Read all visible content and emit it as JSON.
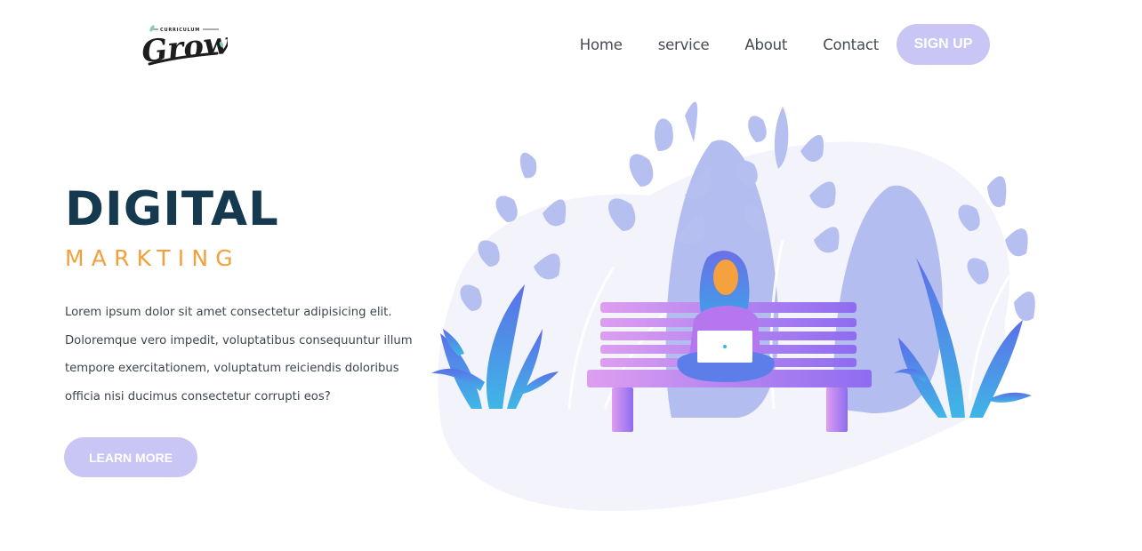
{
  "brand": {
    "logo_text": "Grow",
    "logo_tagline": "CURRICULUM"
  },
  "nav": {
    "items": [
      "Home",
      "service",
      "About",
      "Contact"
    ],
    "signup_label": "SIGN UP"
  },
  "hero": {
    "title": "DIGITAL",
    "subtitle": "MARKTING",
    "paragraph": "Lorem ipsum dolor sit amet consectetur adipisicing elit. Doloremque vero impedit, voluptatibus consequuntur illum tempore exercitationem, voluptatum reiciendis doloribus officia nisi ducimus consectetur corrupti eos?",
    "button_label": "LEARN MORE"
  },
  "colors": {
    "accent": "#c9c6f6",
    "title": "#153a4f",
    "subtitle": "#f2a03d"
  }
}
